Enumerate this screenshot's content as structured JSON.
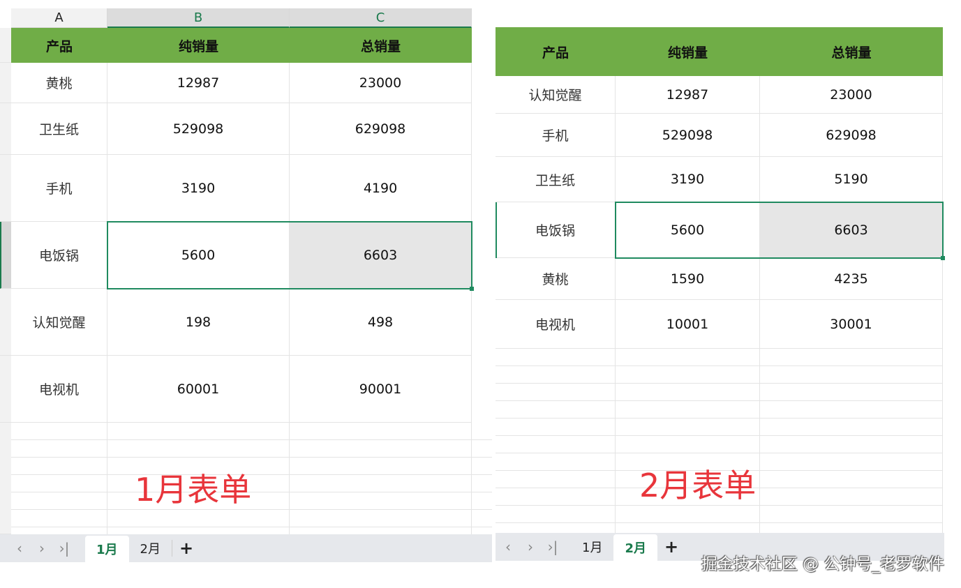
{
  "sheet1": {
    "columns": [
      "A",
      "B",
      "C"
    ],
    "header": [
      "产品",
      "纯销量",
      "总销量"
    ],
    "rows": [
      [
        "黄桃",
        "12987",
        "23000"
      ],
      [
        "卫生纸",
        "529098",
        "629098"
      ],
      [
        "手机",
        "3190",
        "4190"
      ],
      [
        "电饭锅",
        "5600",
        "6603"
      ],
      [
        "认知觉醒",
        "198",
        "498"
      ],
      [
        "电视机",
        "60001",
        "90001"
      ]
    ],
    "caption": "1月表单",
    "tabs": [
      "1月",
      "2月"
    ],
    "active_tab": "1月"
  },
  "sheet2": {
    "header": [
      "产品",
      "纯销量",
      "总销量"
    ],
    "rows": [
      [
        "认知觉醒",
        "12987",
        "23000"
      ],
      [
        "手机",
        "529098",
        "629098"
      ],
      [
        "卫生纸",
        "3190",
        "5190"
      ],
      [
        "电饭锅",
        "5600",
        "6603"
      ],
      [
        "黄桃",
        "1590",
        "4235"
      ],
      [
        "电视机",
        "10001",
        "30001"
      ]
    ],
    "caption": "2月表单",
    "tabs": [
      "1月",
      "2月"
    ],
    "active_tab": "2月"
  },
  "nav_icons": [
    "first-sheet-icon",
    "prev-sheet-icon",
    "next-sheet-icon",
    "last-sheet-icon"
  ],
  "add_sheet_symbol": "+",
  "watermark": "掘金技术社区 @ 公钟号_老罗软件",
  "colors": {
    "header_green": "#70ad47",
    "selection_green": "#1f8a5f",
    "caption_red": "#e8353b"
  }
}
